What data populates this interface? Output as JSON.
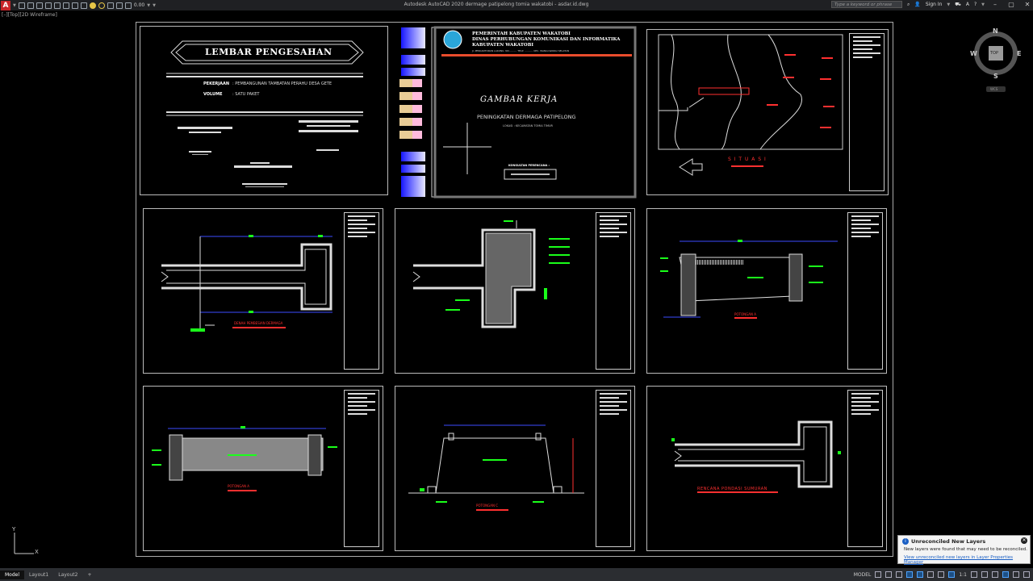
{
  "titlebar": {
    "app_icon": "A",
    "lineweight_value": "0.00",
    "window_title": "Autodesk AutoCAD 2020   dermage patipelong tomia wakatobi - asdar.id.dwg",
    "search_placeholder": "Type a keyword or phrase",
    "sign_in": "Sign In",
    "minimize": "–",
    "maximize": "▢",
    "close": "✕"
  },
  "viewport": {
    "view_label": "[–][Top][2D Wireframe]"
  },
  "compass": {
    "north": "N",
    "south": "S",
    "east": "E",
    "west": "W",
    "top": "TOP",
    "ucs": "WCS"
  },
  "ucs_icon": {
    "y": "Y",
    "x": "X"
  },
  "sheets": {
    "s1": {
      "title": "LEMBAR PENGESAHAN",
      "pekerjaan_label": "PEKERJAAN",
      "pekerjaan_value": ": PEMBANGUNAN TAMBATAN PERAHU DESA GETE",
      "volume_label": "VOLUME",
      "volume_value": ": SATU PAKET"
    },
    "s2": {
      "header_line1": "PEMERINTAH KABUPATEN WAKATOBI",
      "header_line2": "DINAS PERHUBUNGAN KOMUNIKASI DAN INFORMATIKA",
      "header_line3": "KABUPATEN WAKATOBI",
      "header_line4": "Jl. PERKANTORAN LAKUNU, NO........., TELP. ........... KEC. WANGI-WANGI SELATAN",
      "main_title": "GAMBAR KERJA",
      "subtitle": "PENINGKATAN DERMAGA PATIPELONG",
      "location": "LOKASI : KECAMATAN TOMIA TIMUR",
      "consultant": "KONSULTAN PERENCANA :"
    },
    "s3": {
      "label": "S I T U A S I"
    },
    "s4": {
      "label": "DENAH PEMBESIAN DERMAGA"
    },
    "s6": {
      "label": "POTONGAN A"
    },
    "s7": {
      "label": "POTONGAN A"
    },
    "s8": {
      "label": "POTONGAN C"
    },
    "s9": {
      "label": "RENCANA PONDASI SUMURAN"
    }
  },
  "tabs": [
    {
      "label": "Model"
    },
    {
      "label": "Layout1"
    },
    {
      "label": "Layout2"
    },
    {
      "label": "+"
    }
  ],
  "status": {
    "model_label": "MODEL",
    "scale": "1:1"
  },
  "notification": {
    "title": "Unreconciled New Layers",
    "message": "New layers were found that may need to be reconciled.",
    "link": "View unreconciled new layers in Layer Properties Manager",
    "close": "✕",
    "info": "i"
  }
}
